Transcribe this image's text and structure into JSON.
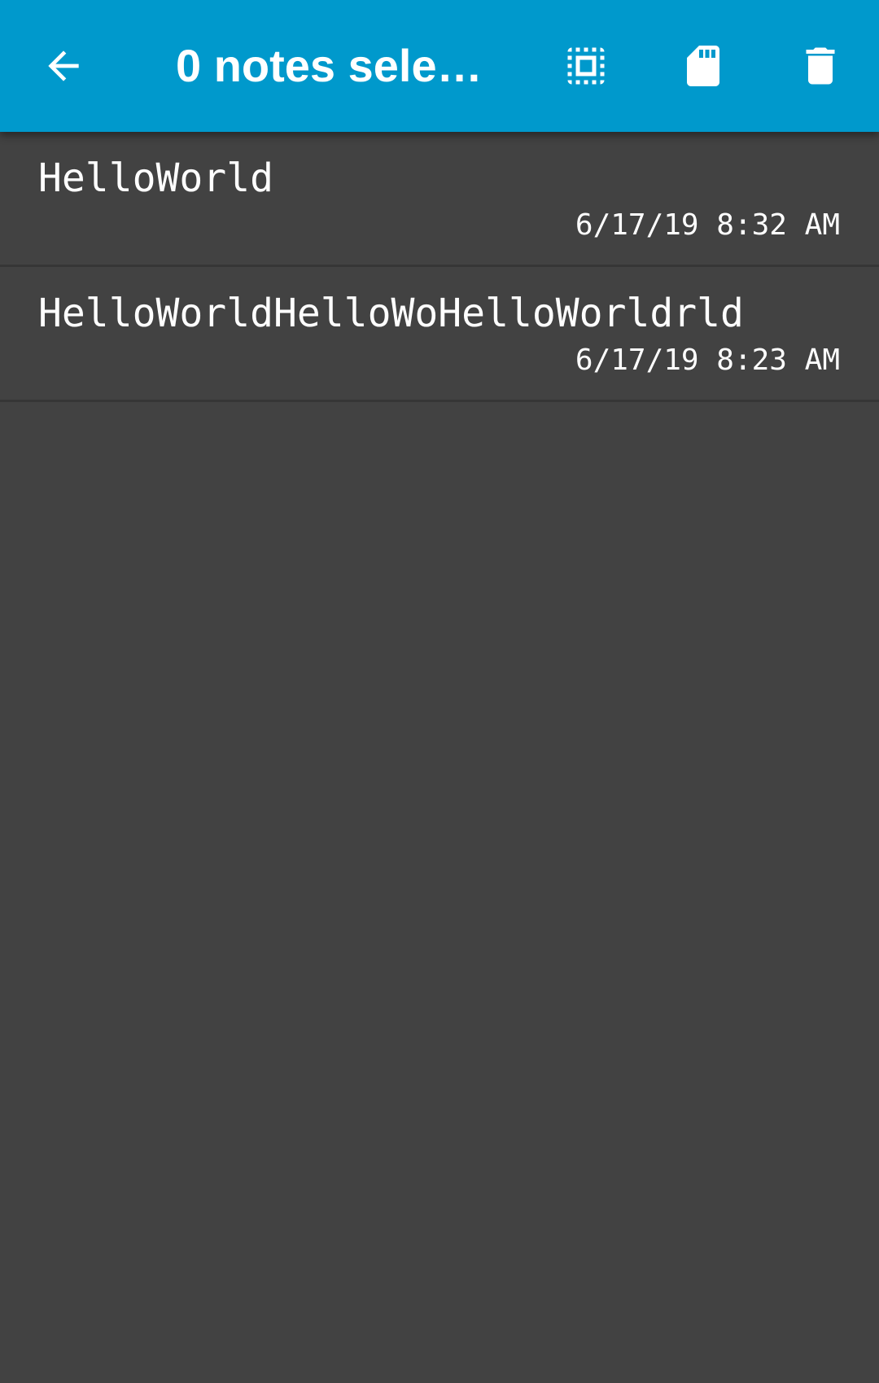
{
  "toolbar": {
    "title": "0 notes selec…",
    "background_color": "#0099cc",
    "icons": {
      "back": "arrow-back-icon",
      "select_all": "select-all-icon",
      "save": "sd-card-icon",
      "delete": "trash-icon"
    }
  },
  "notes": [
    {
      "title": "HelloWorld",
      "date": "6/17/19 8:32 AM"
    },
    {
      "title": "HelloWorldHelloWoHelloWorldrld",
      "date": "6/17/19 8:23 AM"
    }
  ],
  "colors": {
    "background": "#424242",
    "divider": "#363636",
    "text": "#ffffff"
  }
}
